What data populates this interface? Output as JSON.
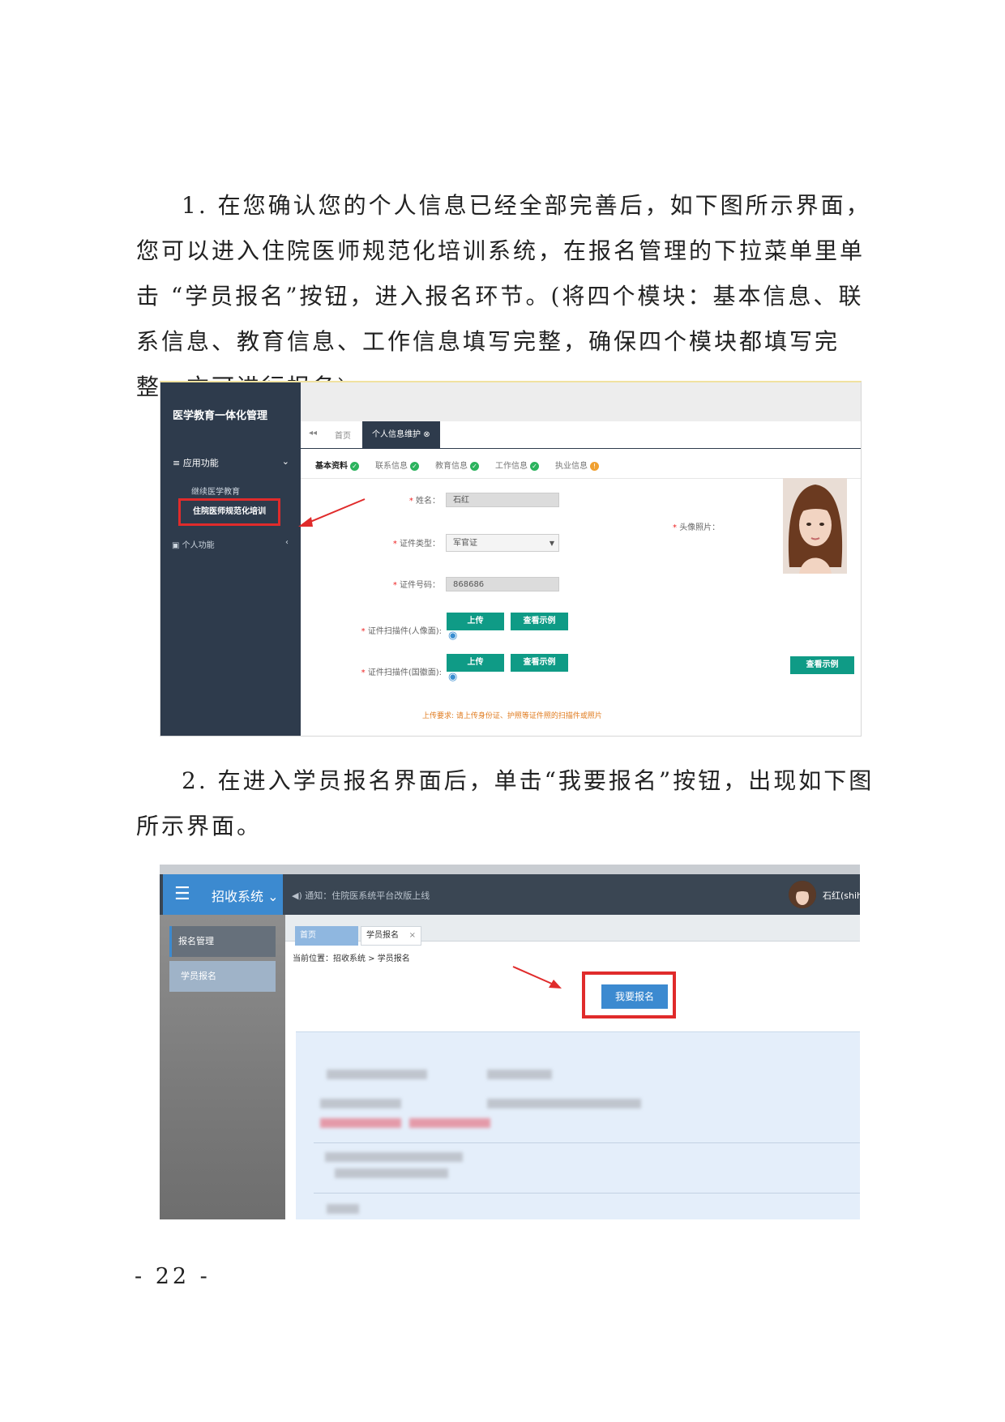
{
  "doc": {
    "para1": "1. 在您确认您的个人信息已经全部完善后，如下图所示界面，您可以进入住院医师规范化培训系统，在报名管理的下拉菜单里单击 “学员报名”按钮，进入报名环节。(将四个模块：基本信息、联系信息、教育信息、工作信息填写完整，确保四个模块都填写完整，方可进行报名)",
    "para2": "2. 在进入学员报名界面后，单击“我要报名”按钮，出现如下图所示界面。",
    "page_number": "- 22 -"
  },
  "shot1": {
    "brand": "医学教育一体化管理",
    "menu_app": "应用功能",
    "menu_app_sub1": "继续医学教育",
    "menu_app_sub2": "住院医师规范化培训",
    "menu_personal": "个人功能",
    "tab_nav": "◂◂",
    "tab_home": "首页",
    "tab_active": "个人信息维护",
    "subtabs": [
      "基本资料",
      "联系信息",
      "教育信息",
      "工作信息",
      "执业信息"
    ],
    "label_name": "姓名：",
    "value_name": "石红",
    "label_idtype": "证件类型：",
    "value_idtype": "军官证",
    "label_idno": "证件号码：",
    "value_idno": "868686",
    "label_scan_front": "证件扫描件(人像面):",
    "label_scan_back": "证件扫描件(国徽面):",
    "btn_upload": "上传",
    "btn_example": "查看示例",
    "label_photo": "头像照片：",
    "upload_note": "上传要求: 请上传身份证、护照等证件照的扫描件或照片"
  },
  "shot2": {
    "brand": "招收系统",
    "notice": "通知：住院医系统平台改版上线",
    "user": "石红(shiho",
    "side_manage": "报名管理",
    "side_register": "学员报名",
    "tab_home": "首页",
    "tab_register": "学员报名",
    "tab_close": "×",
    "breadcrumb": "当前位置：招收系统 > 学员报名",
    "btn_register": "我要报名"
  },
  "colors": {
    "sidebar": "#2e3b4c",
    "teal": "#0f9b86",
    "blue": "#3c8ad0",
    "highlight": "#e02b2b"
  }
}
